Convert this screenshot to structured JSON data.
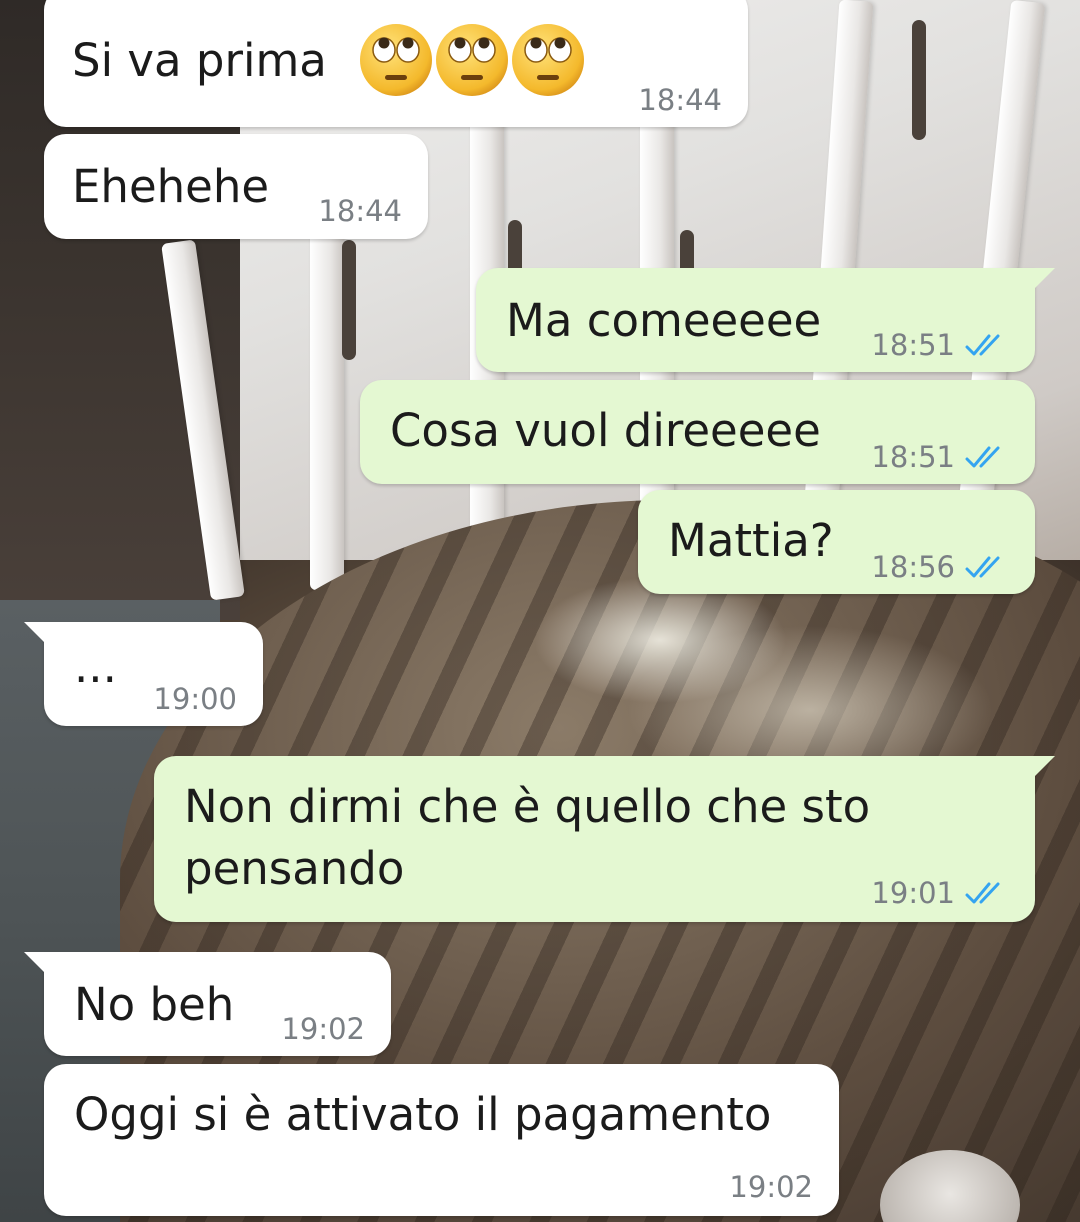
{
  "colors": {
    "incoming_bubble": "#ffffff",
    "outgoing_bubble": "#e4f8d2",
    "read_tick": "#34a4f0",
    "time_text": "#7a7f84"
  },
  "messages": [
    {
      "direction": "in",
      "text": "Si va prima",
      "emoji": [
        "face-with-rolling-eyes-icon",
        "face-with-rolling-eyes-icon",
        "face-with-rolling-eyes-icon"
      ],
      "time": "18:44"
    },
    {
      "direction": "in",
      "text": "Ehehehe",
      "time": "18:44"
    },
    {
      "direction": "out",
      "text": "Ma comeeeee",
      "time": "18:51",
      "status": "read"
    },
    {
      "direction": "out",
      "text": "Cosa vuol direeeee",
      "time": "18:51",
      "status": "read"
    },
    {
      "direction": "out",
      "text": "Mattia?",
      "time": "18:56",
      "status": "read"
    },
    {
      "direction": "in",
      "text": "...",
      "time": "19:00"
    },
    {
      "direction": "out",
      "text": "Non dirmi che è quello che sto pensando",
      "time": "19:01",
      "status": "read"
    },
    {
      "direction": "in",
      "text": "No beh",
      "time": "19:02"
    },
    {
      "direction": "in",
      "text": "Oggi si è attivato il pagamento",
      "time": "19:02"
    }
  ]
}
